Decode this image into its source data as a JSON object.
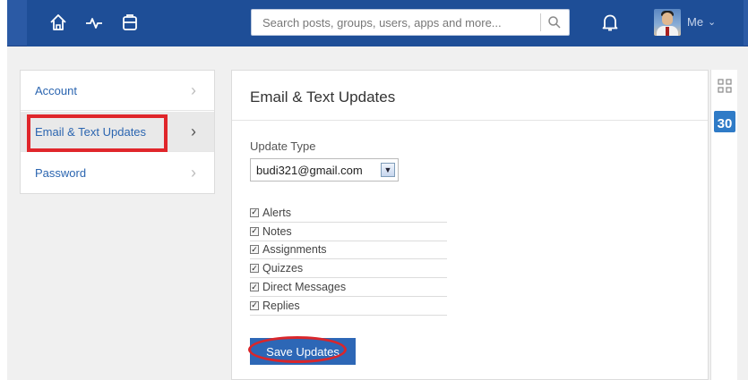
{
  "topbar": {
    "search_placeholder": "Search posts, groups, users, apps and more...",
    "me_label": "Me",
    "icons": [
      "home-icon",
      "activity-icon",
      "backpack-icon",
      "search-icon",
      "bell-icon",
      "chevron-down-icon"
    ]
  },
  "sidebar": {
    "items": [
      {
        "label": "Account"
      },
      {
        "label": "Email & Text Updates"
      },
      {
        "label": "Password"
      }
    ]
  },
  "main": {
    "title": "Email & Text Updates",
    "update_type_label": "Update Type",
    "update_type_value": "budi321@gmail.com",
    "checkboxes": [
      {
        "label": "Alerts",
        "checked": true
      },
      {
        "label": "Notes",
        "checked": true
      },
      {
        "label": "Assignments",
        "checked": true
      },
      {
        "label": "Quizzes",
        "checked": true
      },
      {
        "label": "Direct Messages",
        "checked": true
      },
      {
        "label": "Replies",
        "checked": true
      }
    ],
    "save_label": "Save Updates"
  },
  "rightrail": {
    "calendar_day": "30"
  },
  "colors": {
    "topbar": "#1e4e97",
    "link": "#2b65b0",
    "button": "#2d67b6",
    "highlight": "#e0262b"
  }
}
